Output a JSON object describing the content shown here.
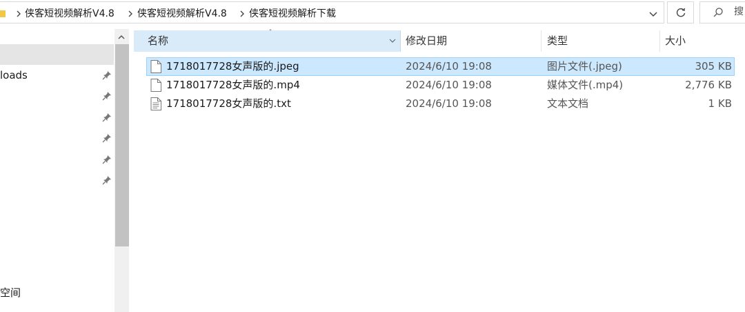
{
  "address_bar": {
    "crumbs": [
      "侠客短视频解析V4.8",
      "侠客短视频解析V4.8",
      "侠客短视频解析下载"
    ]
  },
  "search": {
    "placeholder": "搜"
  },
  "nav": {
    "items": [
      {
        "label": "loads",
        "pinned": true
      },
      {
        "label": "",
        "pinned": true
      },
      {
        "label": "",
        "pinned": true
      },
      {
        "label": "",
        "pinned": true
      },
      {
        "label": "",
        "pinned": true
      },
      {
        "label": "",
        "pinned": true
      }
    ],
    "bottom_label": "空间"
  },
  "columns": {
    "name": "名称",
    "date": "修改日期",
    "type": "类型",
    "size": "大小"
  },
  "files": [
    {
      "name": "1718017728女声版的.jpeg",
      "date": "2024/6/10 19:08",
      "type": "图片文件(.jpeg)",
      "size": "305 KB",
      "selected": true
    },
    {
      "name": "1718017728女声版的.mp4",
      "date": "2024/6/10 19:08",
      "type": "媒体文件(.mp4)",
      "size": "2,776 KB",
      "selected": false
    },
    {
      "name": "1718017728女声版的.txt",
      "date": "2024/6/10 19:08",
      "type": "文本文档",
      "size": "1 KB",
      "selected": false
    }
  ],
  "colors": {
    "selection_bg": "#cce8ff",
    "selection_border": "#99d1ff",
    "header_active_bg": "#d9ebf9",
    "folder_yellow": "#f2c744"
  }
}
